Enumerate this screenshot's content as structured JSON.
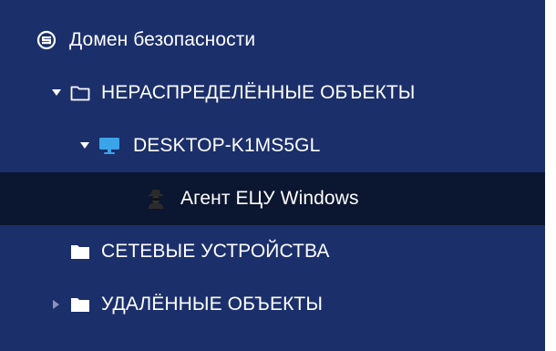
{
  "tree": {
    "root": {
      "icon": "security-domain-icon",
      "label": "Домен безопасности"
    },
    "unassigned": {
      "expanded": true,
      "icon": "folder-outline-icon",
      "label": "НЕРАСПРЕДЕЛЁННЫЕ ОБЪЕКТЫ"
    },
    "desktop": {
      "expanded": true,
      "icon": "monitor-icon",
      "label": "DESKTOP-K1MS5GL"
    },
    "agent": {
      "selected": true,
      "icon": "agent-icon",
      "label": "Агент ЕЦУ Windows"
    },
    "network_devices": {
      "icon": "folder-icon",
      "label": "СЕТЕВЫЕ УСТРОЙСТВА"
    },
    "deleted": {
      "expanded": false,
      "icon": "folder-icon",
      "label": "УДАЛЁННЫЕ ОБЪЕКТЫ"
    }
  },
  "colors": {
    "background": "#1b2f6b",
    "selected_row": "#0b1630",
    "text": "#ffffff",
    "monitor": "#3ba3e8",
    "caret_collapsed": "#8a94b8"
  }
}
